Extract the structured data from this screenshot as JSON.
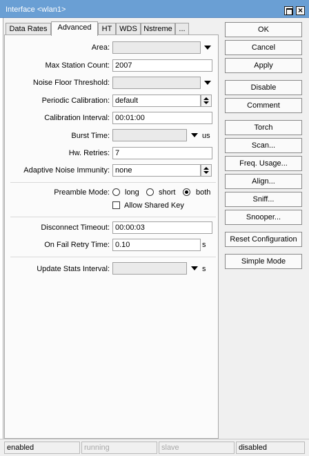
{
  "window": {
    "title": "Interface <wlan1>"
  },
  "tabs": [
    {
      "label": "Data Rates"
    },
    {
      "label": "Advanced"
    },
    {
      "label": "HT"
    },
    {
      "label": "WDS"
    },
    {
      "label": "Nstreme"
    },
    {
      "label": "..."
    }
  ],
  "active_tab": "Advanced",
  "form": {
    "area": {
      "label": "Area:",
      "value": ""
    },
    "max_station_count": {
      "label": "Max Station Count:",
      "value": "2007"
    },
    "noise_floor_threshold": {
      "label": "Noise Floor Threshold:",
      "value": ""
    },
    "periodic_calibration": {
      "label": "Periodic Calibration:",
      "value": "default"
    },
    "calibration_interval": {
      "label": "Calibration Interval:",
      "value": "00:01:00"
    },
    "burst_time": {
      "label": "Burst Time:",
      "value": "",
      "unit": "us"
    },
    "hw_retries": {
      "label": "Hw. Retries:",
      "value": "7"
    },
    "adaptive_noise_immunity": {
      "label": "Adaptive Noise Immunity:",
      "value": "none"
    },
    "preamble_mode": {
      "label": "Preamble Mode:",
      "options": [
        "long",
        "short",
        "both"
      ],
      "selected": "both"
    },
    "allow_shared_key": {
      "label": "Allow Shared Key",
      "checked": false
    },
    "disconnect_timeout": {
      "label": "Disconnect Timeout:",
      "value": "00:00:03"
    },
    "on_fail_retry_time": {
      "label": "On Fail Retry Time:",
      "value": "0.10",
      "unit": "s"
    },
    "update_stats_interval": {
      "label": "Update Stats Interval:",
      "value": "",
      "unit": "s"
    }
  },
  "buttons": {
    "ok": "OK",
    "cancel": "Cancel",
    "apply": "Apply",
    "disable": "Disable",
    "comment": "Comment",
    "torch": "Torch",
    "scan": "Scan...",
    "freq_usage": "Freq. Usage...",
    "align": "Align...",
    "sniff": "Sniff...",
    "snooper": "Snooper...",
    "reset_configuration": "Reset Configuration",
    "simple_mode": "Simple Mode"
  },
  "status_bar": [
    "enabled",
    "running",
    "slave",
    "disabled"
  ],
  "icons": {
    "maximize": "maximize-icon",
    "close": "close-icon",
    "dropdown": "dropdown-arrow-icon",
    "spinner": "spinner-icon"
  },
  "colors": {
    "titlebar": "#6a9fd4",
    "panel": "#fbfbfb",
    "disabled_field": "#eaeaea"
  }
}
